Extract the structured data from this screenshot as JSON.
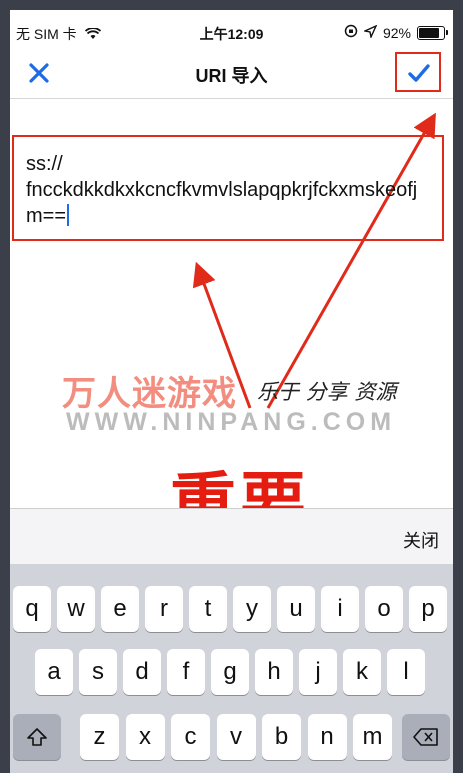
{
  "status_bar": {
    "carrier": "无 SIM 卡",
    "time": "上午12:09",
    "battery": "92%",
    "battery_level": 0.92
  },
  "nav": {
    "title": "URI 导入"
  },
  "uri_input": {
    "value": "ss://\nfncckdkkdkxkcncfkvmvlslapqpkrjfckxmskeofjm=="
  },
  "watermark": {
    "brand": "万人迷游戏",
    "slogan": "乐于 分享 资源",
    "url": "WWW.NINPANG.COM"
  },
  "annotation": {
    "label": "重要"
  },
  "keyboard": {
    "done_label": "关闭",
    "row1": [
      "q",
      "w",
      "e",
      "r",
      "t",
      "y",
      "u",
      "i",
      "o",
      "p"
    ],
    "row2": [
      "a",
      "s",
      "d",
      "f",
      "g",
      "h",
      "j",
      "k",
      "l"
    ],
    "row3": [
      "z",
      "x",
      "c",
      "v",
      "b",
      "n",
      "m"
    ]
  },
  "colors": {
    "accent": "#1e6be6",
    "annotation_red": "#e02a1a"
  }
}
